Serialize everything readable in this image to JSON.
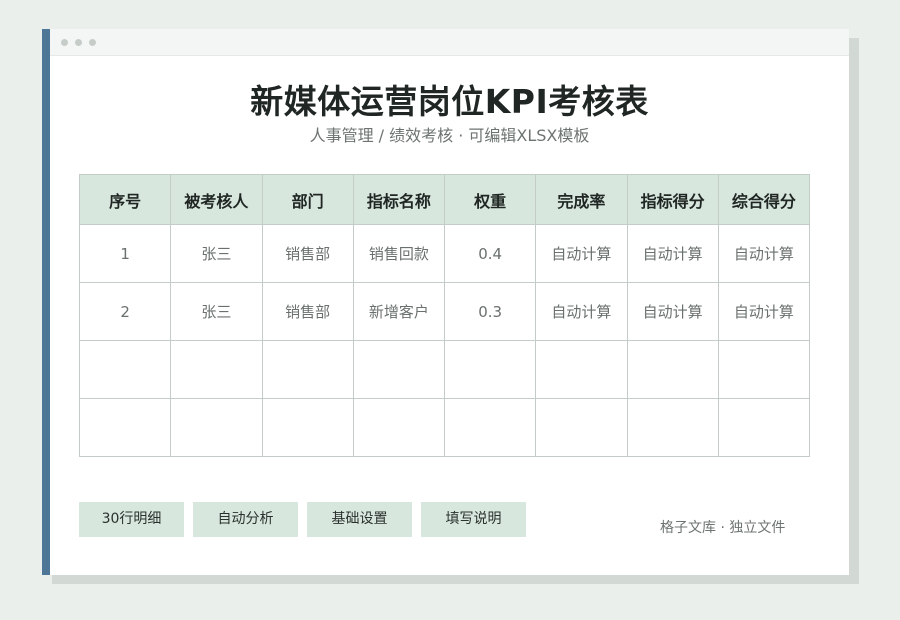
{
  "document": {
    "title": "新媒体运营岗位KPI考核表",
    "subtitle": "人事管理 / 绩效考核 · 可编辑XLSX模板"
  },
  "table": {
    "headers": [
      "序号",
      "被考核人",
      "部门",
      "指标名称",
      "权重",
      "完成率",
      "指标得分",
      "综合得分"
    ],
    "rows": [
      [
        "1",
        "张三",
        "销售部",
        "销售回款",
        "0.4",
        "自动计算",
        "自动计算",
        "自动计算"
      ],
      [
        "2",
        "张三",
        "销售部",
        "新增客户",
        "0.3",
        "自动计算",
        "自动计算",
        "自动计算"
      ],
      [
        "",
        "",
        "",
        "",
        "",
        "",
        "",
        ""
      ],
      [
        "",
        "",
        "",
        "",
        "",
        "",
        "",
        ""
      ]
    ]
  },
  "sheet_tabs": [
    "30行明细",
    "自动分析",
    "基础设置",
    "填写说明"
  ],
  "footer": {
    "note": "格子文库 · 独立文件"
  },
  "colors": {
    "accent_bar": "#4e7697",
    "header_fill": "#d8e7de",
    "background": "#ebefec"
  }
}
